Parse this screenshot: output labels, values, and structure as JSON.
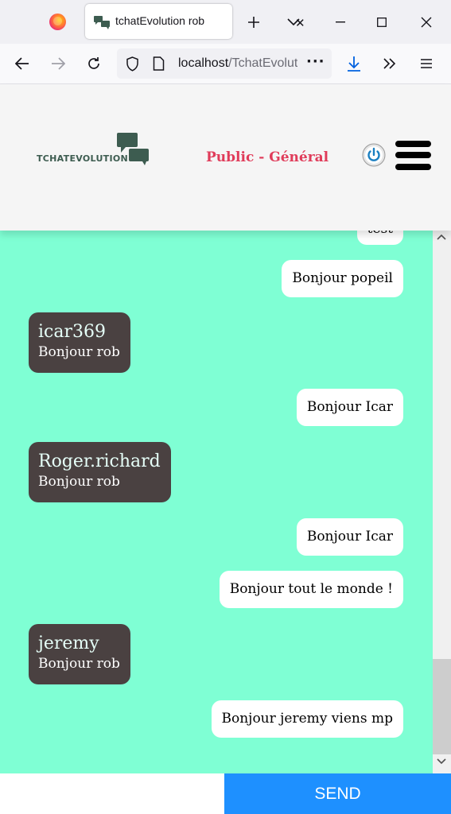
{
  "browser": {
    "tab_title": "tchatEvolution rob",
    "url_host": "localhost",
    "url_path": "/TchatEvolution",
    "icons": [
      "firefox-icon",
      "tab-favicon",
      "close-icon",
      "new-tab-icon",
      "tab-list-icon",
      "minimize-icon",
      "maximize-icon",
      "window-close-icon",
      "back-icon",
      "forward-icon",
      "reload-icon",
      "shield-icon",
      "page-icon",
      "more-icon",
      "download-icon",
      "overflow-icon",
      "menu-icon"
    ]
  },
  "app": {
    "logo_text": "TCHATEVOLUTION",
    "room_title": "Public - Général",
    "icons": [
      "chat-bubbles-icon",
      "power-icon",
      "hamburger-menu-icon"
    ],
    "accent_color": "#e03c5a",
    "chat_background": "#7fffd4",
    "incoming_bubble_color": "#4a4141"
  },
  "chat": {
    "partial_top_text": "test",
    "messages": [
      {
        "direction": "out",
        "text": "Bonjour popeil"
      },
      {
        "direction": "in",
        "user": "icar369",
        "text": "Bonjour rob"
      },
      {
        "direction": "out",
        "text": "Bonjour Icar"
      },
      {
        "direction": "in",
        "user": "Roger.richard",
        "text": "Bonjour rob"
      },
      {
        "direction": "out",
        "text": "Bonjour Icar"
      },
      {
        "direction": "out",
        "text": "Bonjour tout le monde !"
      },
      {
        "direction": "in",
        "user": "jeremy",
        "text": "Bonjour rob"
      },
      {
        "direction": "out",
        "text": "Bonjour jeremy viens mp"
      }
    ]
  },
  "composer": {
    "input_value": "",
    "send_label": "SEND",
    "send_color": "#1e90ff"
  }
}
